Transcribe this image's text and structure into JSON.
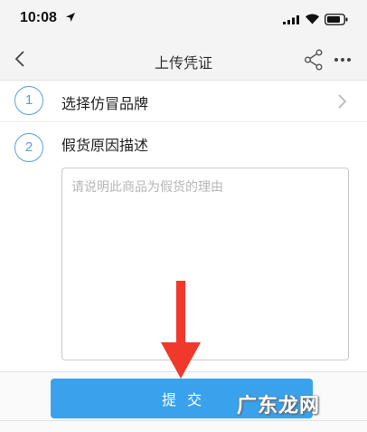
{
  "status_bar": {
    "time": "10:08",
    "icons": [
      "location-arrow-icon",
      "signal-icon",
      "wifi-icon",
      "battery-icon"
    ]
  },
  "nav": {
    "title": "上传凭证",
    "back_icon": "chevron-left-icon",
    "share_icon": "share-icon",
    "more_icon": "more-icon"
  },
  "steps": [
    {
      "number": "1",
      "label": "选择仿冒品牌"
    },
    {
      "number": "2",
      "label": "假货原因描述"
    }
  ],
  "reason_input": {
    "value": "",
    "placeholder": "请说明此商品为假货的理由"
  },
  "submit": {
    "label": "提交"
  },
  "annotation": {
    "arrow_color": "#f0382b"
  },
  "watermark": {
    "text": "广东龙网"
  },
  "colors": {
    "accent": "#3aa2ec",
    "step_circle": "#5aa0db",
    "placeholder": "#b7b7b7"
  }
}
